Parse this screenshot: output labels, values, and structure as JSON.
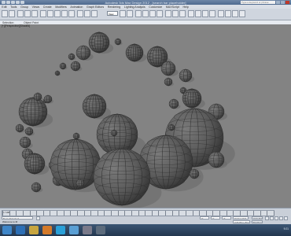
{
  "window": {
    "title": "Autodesk 3ds Max Design 2012 - [search bar placeholder]",
    "search_placeholder": "Type a keyword or phrase"
  },
  "menu": {
    "items": [
      "Edit",
      "Tools",
      "Group",
      "Views",
      "Create",
      "Modifiers",
      "Animation",
      "Graph Editors",
      "Rendering",
      "Lighting Analysis",
      "Customize",
      "MAXScript",
      "Help"
    ]
  },
  "toolbar": {
    "view_selector": "View"
  },
  "ribbon": {
    "left_label": "Selection",
    "right_label": "Object Paint"
  },
  "viewport": {
    "label": "[+][Perspective][Shaded]",
    "background": "#838383",
    "sphere_color": "#5b5b5b",
    "wire_color": "#2a2a2a"
  },
  "statusbar": {
    "frame_range": "0 / 100",
    "selected": "None Selected",
    "coord_x": "X:",
    "coord_y": "Y:",
    "coord_z": "Z:",
    "grid": "Grid = 10.0",
    "auto_key": "Auto Key",
    "set_key": "Set Key",
    "add_time_tag": "Add Time Tag",
    "welcome": "Welcome to M"
  },
  "taskbar": {
    "time": "9:21"
  }
}
